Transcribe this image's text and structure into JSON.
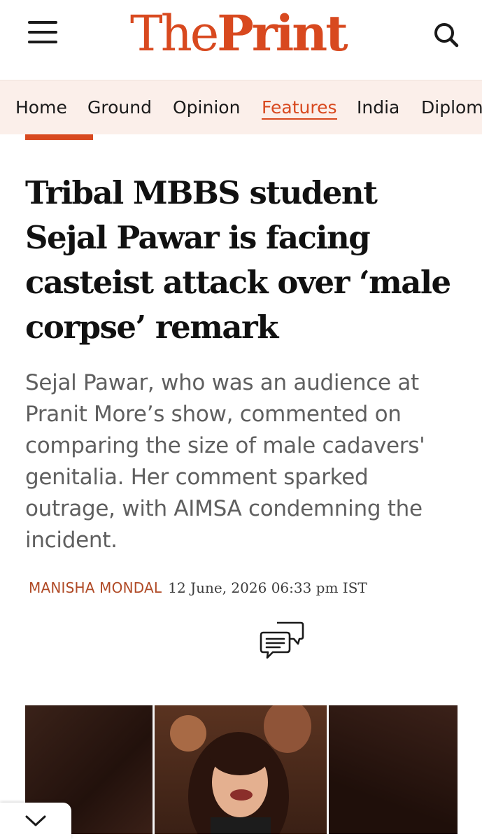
{
  "header": {
    "logo_the": "The",
    "logo_print": "Print",
    "menu_icon": "hamburger-menu-icon",
    "search_icon": "search-icon"
  },
  "nav": {
    "items": [
      {
        "label": "Home",
        "active": false
      },
      {
        "label": "Ground",
        "active": false
      },
      {
        "label": "Opinion",
        "active": false
      },
      {
        "label": "Features",
        "active": true
      },
      {
        "label": "India",
        "active": false
      },
      {
        "label": "Diplomacy",
        "active": false
      }
    ]
  },
  "article": {
    "headline": "Tribal MBBS student Sejal Pawar is facing casteist attack over ‘male corpse’ remark",
    "dek": "Sejal Pawar, who was an audience at Pranit More’s show, commented on comparing the size of male cadavers' genitalia. Her comment sparked outrage, with AIMSA condemning the incident.",
    "author": "MANISHA MONDAL",
    "dateline": "12 June, 2026 06:33 pm IST",
    "comment_icon": "comments-icon"
  },
  "colors": {
    "brand": "#d8491f",
    "nav_background": "#fbefea",
    "author": "#b04a26",
    "dek": "#5f5f5f"
  },
  "footer": {
    "collapse_icon": "chevron-down-icon"
  }
}
